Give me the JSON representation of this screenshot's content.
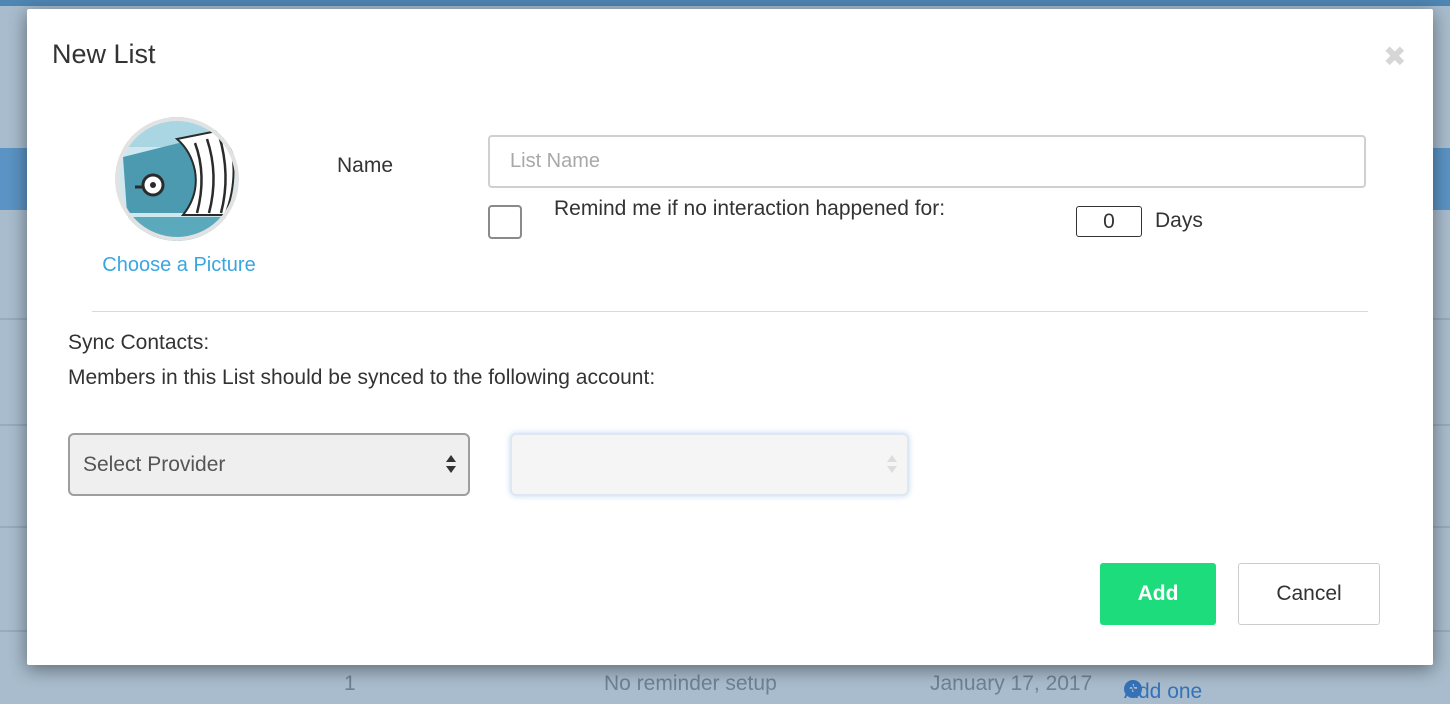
{
  "modal": {
    "title": "New List",
    "close_icon": "close-icon",
    "choose_picture": "Choose a Picture",
    "name_label": "Name",
    "name_placeholder": "List Name",
    "name_value": "",
    "remind_checked": false,
    "remind_label": "Remind me if no interaction happened for:",
    "remind_days": "0",
    "days_label": "Days",
    "sync_heading": "Sync Contacts:",
    "sync_desc": "Members in this List should be synced to the following account:",
    "provider_select": "Select Provider",
    "account_select": "",
    "add_label": "Add",
    "cancel_label": "Cancel"
  },
  "background_row": {
    "count": "1",
    "reminder": "No reminder setup",
    "date": "January 17, 2017",
    "add_link": "Add one"
  },
  "colors": {
    "accent_link": "#3aa6df",
    "add_button": "#1ddc7b"
  }
}
